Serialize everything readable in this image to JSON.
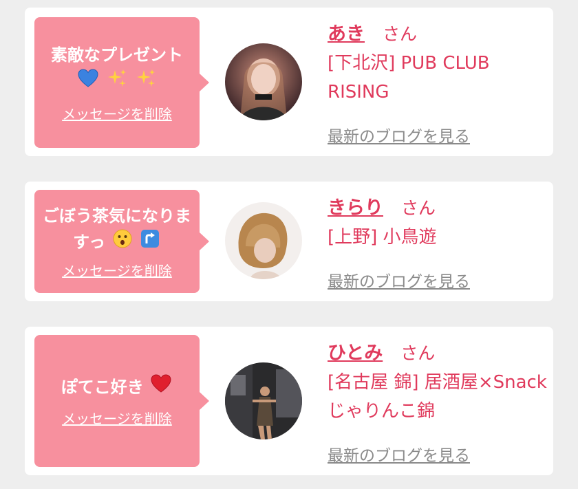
{
  "colors": {
    "accent": "#e03a5c",
    "bubble": "#f7909e",
    "link_gray": "#8a8a8a"
  },
  "cards": [
    {
      "message": "素敵なプレゼント",
      "emojis": [
        "blue-heart-icon",
        "sparkles-icon",
        "sparkles-icon"
      ],
      "delete_label": "メッセージを削除",
      "name": "あき",
      "honorific": "さん",
      "shop": "[下北沢] PUB CLUB RISING",
      "blog_link": "最新のブログを見る"
    },
    {
      "message": "ごぼう茶気になりますっ",
      "emojis": [
        "hushed-face-icon",
        "arrow-up-right-icon"
      ],
      "delete_label": "メッセージを削除",
      "name": "きらり",
      "honorific": "さん",
      "shop": "[上野] 小鳥遊",
      "blog_link": "最新のブログを見る"
    },
    {
      "message": "ぽてこ好き",
      "emojis": [
        "red-heart-icon"
      ],
      "delete_label": "メッセージを削除",
      "name": "ひとみ",
      "honorific": "さん",
      "shop": "[名古屋 錦] 居酒屋×Snack じゃりんこ錦",
      "blog_link": "最新のブログを見る"
    }
  ]
}
